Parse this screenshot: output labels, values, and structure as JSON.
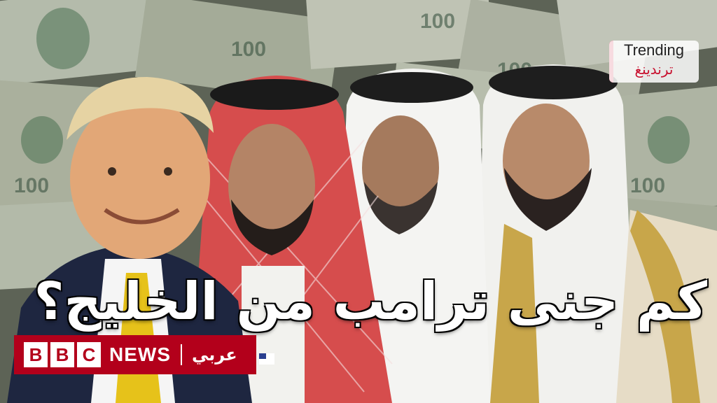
{
  "headline": "كم جنى ترامب من الخليج؟",
  "badge": {
    "bbc_letters": [
      "B",
      "B",
      "C"
    ],
    "news": "NEWS",
    "arabic": "عربي"
  },
  "trending": {
    "english": "Trending",
    "arabic": "ترندينغ"
  },
  "colors": {
    "bbc_red": "#b3001b",
    "trending_red": "#c8102e"
  }
}
